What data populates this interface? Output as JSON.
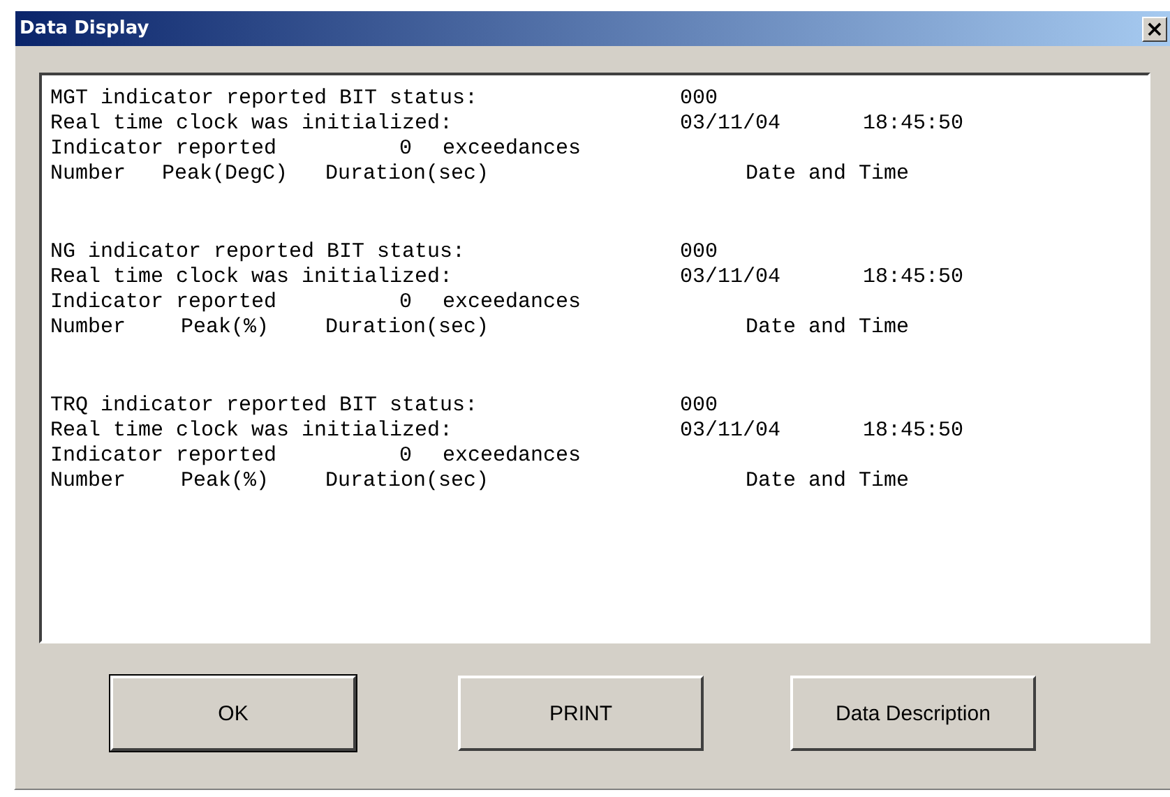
{
  "window": {
    "title": "Data Display",
    "close": "×"
  },
  "sections": [
    {
      "status_label": "MGT indicator reported BIT status:",
      "status_value": "000",
      "clock_label": "Real time clock was initialized:",
      "clock_date": "03/11/04",
      "clock_time": "18:45:50",
      "reported_label": "Indicator reported",
      "count": "0",
      "exceedances_label": "exceedances",
      "headers": [
        "Number",
        "Peak(DegC)",
        "Duration(sec)",
        "Date and Time"
      ]
    },
    {
      "status_label": "NG indicator reported BIT status:",
      "status_value": "000",
      "clock_label": "Real time clock was initialized:",
      "clock_date": "03/11/04",
      "clock_time": "18:45:50",
      "reported_label": "Indicator reported",
      "count": "0",
      "exceedances_label": "exceedances",
      "headers": [
        "Number",
        "Peak(%)",
        "Duration(sec)",
        "Date and Time"
      ]
    },
    {
      "status_label": "TRQ indicator reported BIT status:",
      "status_value": "000",
      "clock_label": "Real time clock was initialized:",
      "clock_date": "03/11/04",
      "clock_time": "18:45:50",
      "reported_label": "Indicator reported",
      "count": "0",
      "exceedances_label": "exceedances",
      "headers": [
        "Number",
        "Peak(%)",
        "Duration(sec)",
        "Date and Time"
      ]
    }
  ],
  "buttons": [
    {
      "label": "OK",
      "default": true
    },
    {
      "label": "PRINT",
      "default": false
    },
    {
      "label": "Data Description",
      "default": false
    }
  ]
}
